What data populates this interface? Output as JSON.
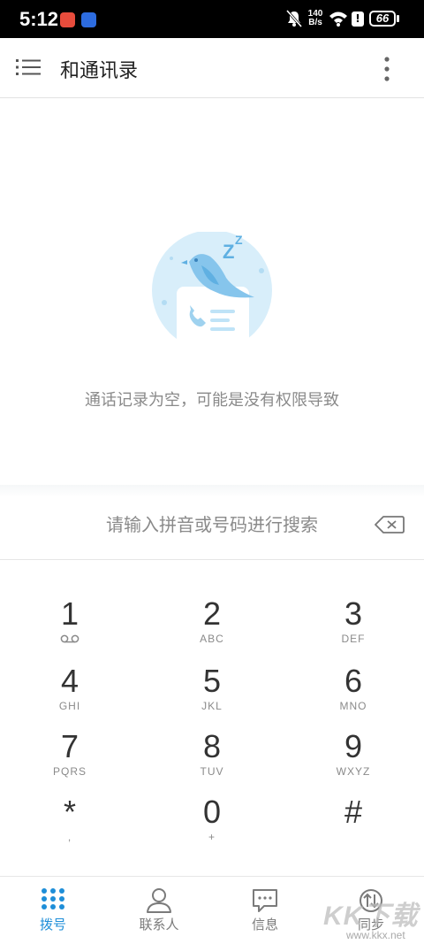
{
  "status_bar": {
    "time": "5:12",
    "net_speed_value": "140",
    "net_speed_unit": "B/s",
    "battery": "66",
    "alert_glyph": "!"
  },
  "app_bar": {
    "title": "和通讯录",
    "menu_icon": "hamburger-menu-icon",
    "more_icon": "more-vertical-icon"
  },
  "empty_state": {
    "message": "通话记录为空，可能是没有权限导致",
    "illustration": "sleeping-bird-phone-illustration"
  },
  "search": {
    "placeholder": "请输入拼音或号码进行搜索",
    "value": ""
  },
  "keypad": {
    "keys": [
      {
        "digit": "1",
        "sub": ""
      },
      {
        "digit": "2",
        "sub": "ABC"
      },
      {
        "digit": "3",
        "sub": "DEF"
      },
      {
        "digit": "4",
        "sub": "GHI"
      },
      {
        "digit": "5",
        "sub": "JKL"
      },
      {
        "digit": "6",
        "sub": "MNO"
      },
      {
        "digit": "7",
        "sub": "PQRS"
      },
      {
        "digit": "8",
        "sub": "TUV"
      },
      {
        "digit": "9",
        "sub": "WXYZ"
      },
      {
        "digit": "*",
        "sub": ","
      },
      {
        "digit": "0",
        "sub": "+"
      },
      {
        "digit": "#",
        "sub": ""
      }
    ]
  },
  "bottom_nav": {
    "items": [
      {
        "label": "拨号",
        "icon": "dialpad-icon",
        "active": true
      },
      {
        "label": "联系人",
        "icon": "person-icon",
        "active": false
      },
      {
        "label": "信息",
        "icon": "message-icon",
        "active": false
      },
      {
        "label": "同步",
        "icon": "sync-icon",
        "active": false
      }
    ]
  },
  "watermark": {
    "brand": "KK下载",
    "url": "www.kkx.net"
  },
  "colors": {
    "accent": "#1e8ed8",
    "illustration_blue": "#bfe3f7",
    "text_secondary": "#8a8a8a"
  }
}
